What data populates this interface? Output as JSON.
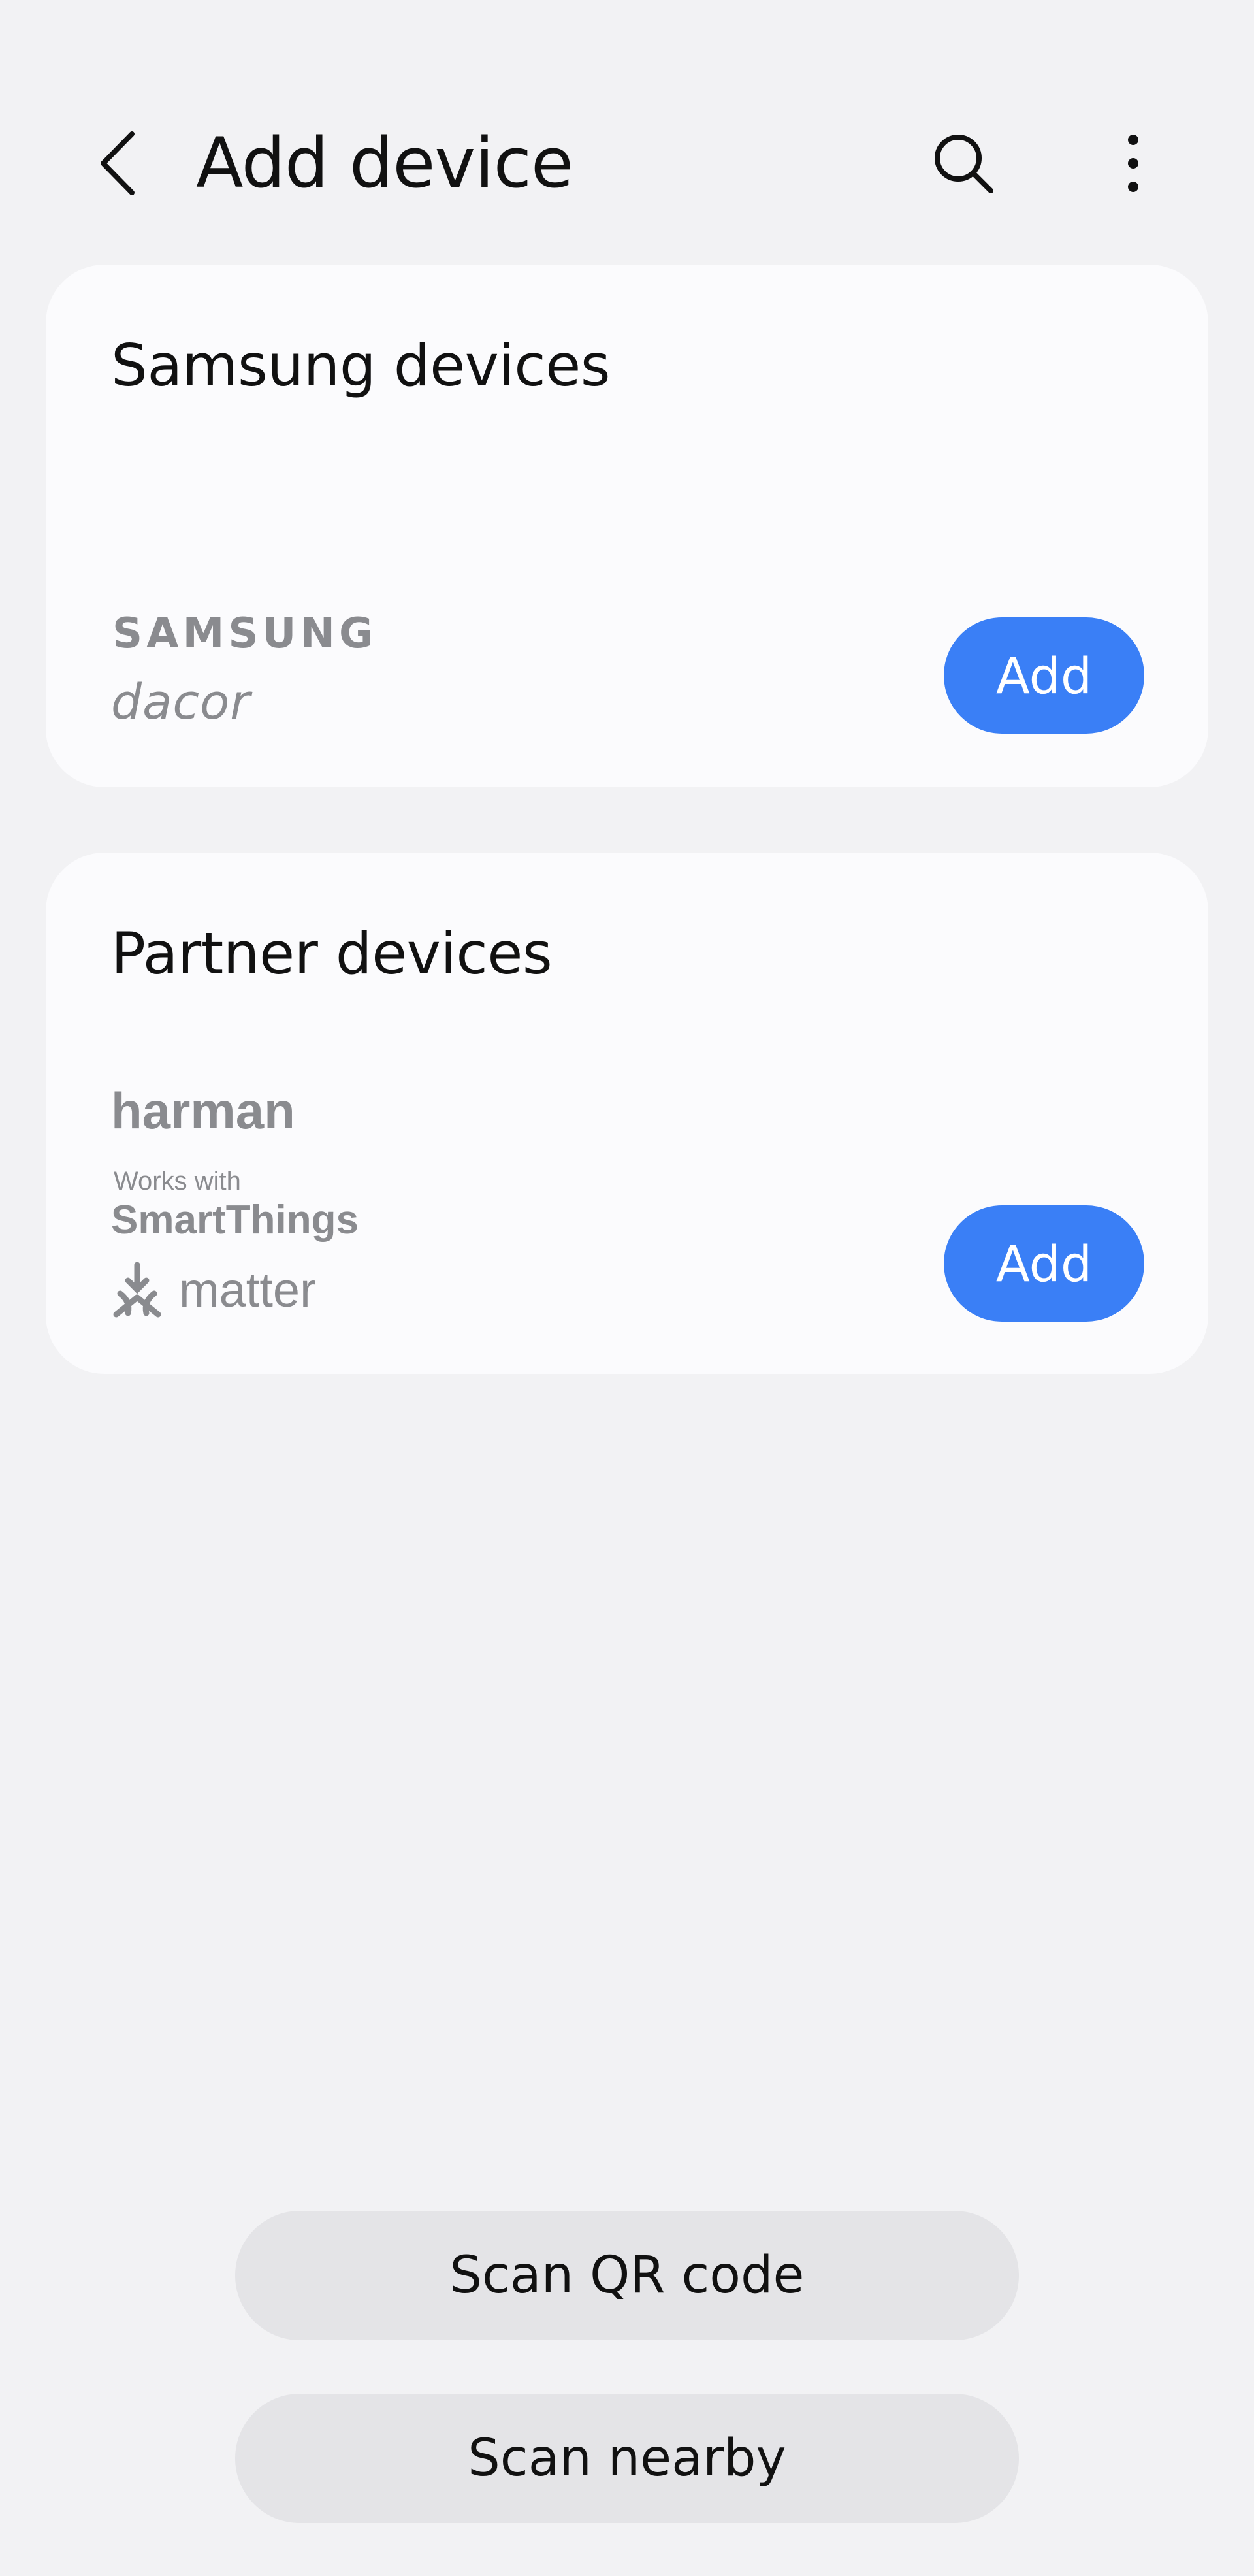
{
  "header": {
    "title": "Add device",
    "icons": {
      "back": "chevron-left-icon",
      "search": "search-icon",
      "more": "more-vertical-icon"
    }
  },
  "cards": {
    "samsung": {
      "title": "Samsung devices",
      "logos": [
        "SAMSUNG",
        "dacor"
      ],
      "add_label": "Add"
    },
    "partner": {
      "title": "Partner devices",
      "logos": [
        "harman",
        "Works with",
        "SmartThings",
        "matter"
      ],
      "add_label": "Add"
    }
  },
  "buttons": {
    "scan_qr": "Scan QR code",
    "scan_nearby": "Scan nearby"
  },
  "colors": {
    "background": "#f2f2f4",
    "card": "#fbfbfd",
    "accent": "#3a7ff6",
    "secondary_button": "#e4e4e7",
    "logo_gray": "#8a8b8f"
  }
}
